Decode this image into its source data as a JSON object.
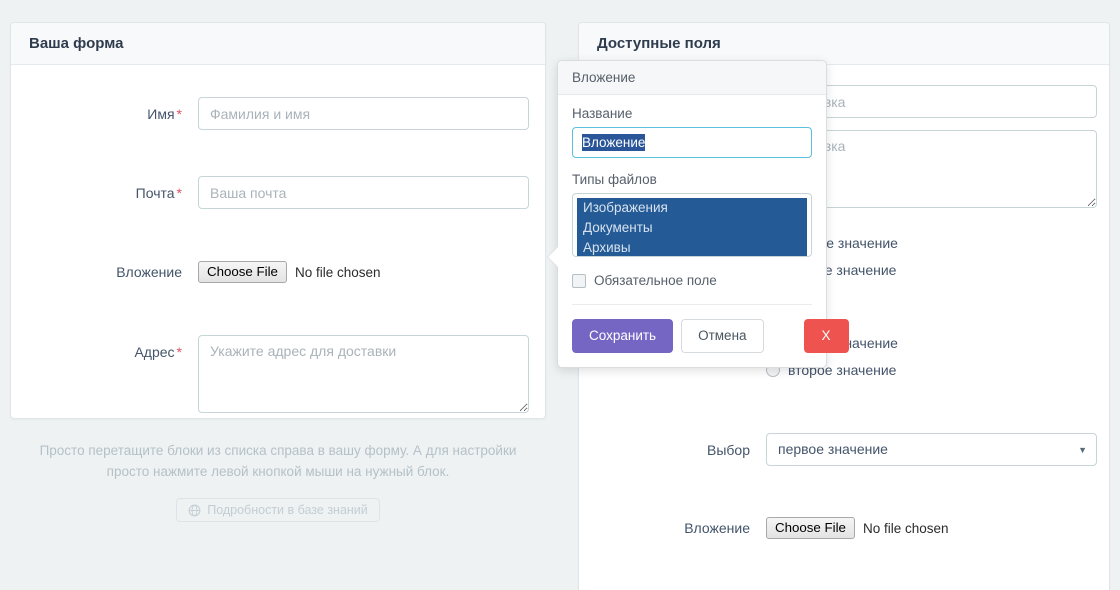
{
  "left_card": {
    "title": "Ваша форма",
    "fields": [
      {
        "label": "Имя",
        "required": true,
        "type": "text",
        "placeholder": "Фамилия и имя",
        "value": ""
      },
      {
        "label": "Почта",
        "required": true,
        "type": "text",
        "placeholder": "Ваша почта",
        "value": ""
      },
      {
        "label": "Вложение",
        "required": false,
        "type": "file",
        "button_label": "Choose File",
        "file_status": "No file chosen"
      },
      {
        "label": "Адрес",
        "required": true,
        "type": "textarea",
        "placeholder": "Укажите адрес для доставки",
        "value": ""
      }
    ]
  },
  "help": {
    "text": "Просто перетащите блоки из списка справа в вашу форму. А для настройки просто нажмите левой кнопкой мыши на нужный блок.",
    "button_label": "Подробности в базе знаний",
    "button_icon": "globe-icon"
  },
  "right_card": {
    "title": "Доступные поля",
    "fields": [
      {
        "label": "",
        "type": "text",
        "placeholder": "Подсказка",
        "value": ""
      },
      {
        "label": "",
        "type": "textarea",
        "placeholder": "Подсказка",
        "value": ""
      },
      {
        "label": "",
        "type": "radio",
        "options": [
          "первое значение",
          "второе значение"
        ]
      },
      {
        "label": "",
        "type": "radio",
        "options": [
          "первое значение",
          "второе значение"
        ]
      },
      {
        "label": "Выбор",
        "type": "select",
        "value": "первое значение",
        "options": [
          "первое значение",
          "второе значение"
        ]
      },
      {
        "label": "Вложение",
        "type": "file",
        "button_label": "Choose File",
        "file_status": "No file chosen"
      }
    ]
  },
  "popup": {
    "header": "Вложение",
    "title_label": "Название",
    "title_value": "Вложение",
    "filetypes_label": "Типы файлов",
    "filetypes": [
      "Изображения",
      "Документы",
      "Архивы"
    ],
    "required_checkbox_label": "Обязательное поле",
    "save_label": "Сохранить",
    "cancel_label": "Отмена",
    "close_label": "X"
  },
  "colors": {
    "page_bg": "#eef2f3",
    "card_bg": "#ffffff",
    "card_header_bg": "#f7f9fa",
    "accent_save": "#7566c4",
    "accent_close": "#ef5350",
    "focus_border": "#5bc0de",
    "selection_bg": "#2a5699",
    "listbox_selected_bg": "#245a96",
    "required_star": "#e05260",
    "help_text": "#b5c1c8"
  }
}
